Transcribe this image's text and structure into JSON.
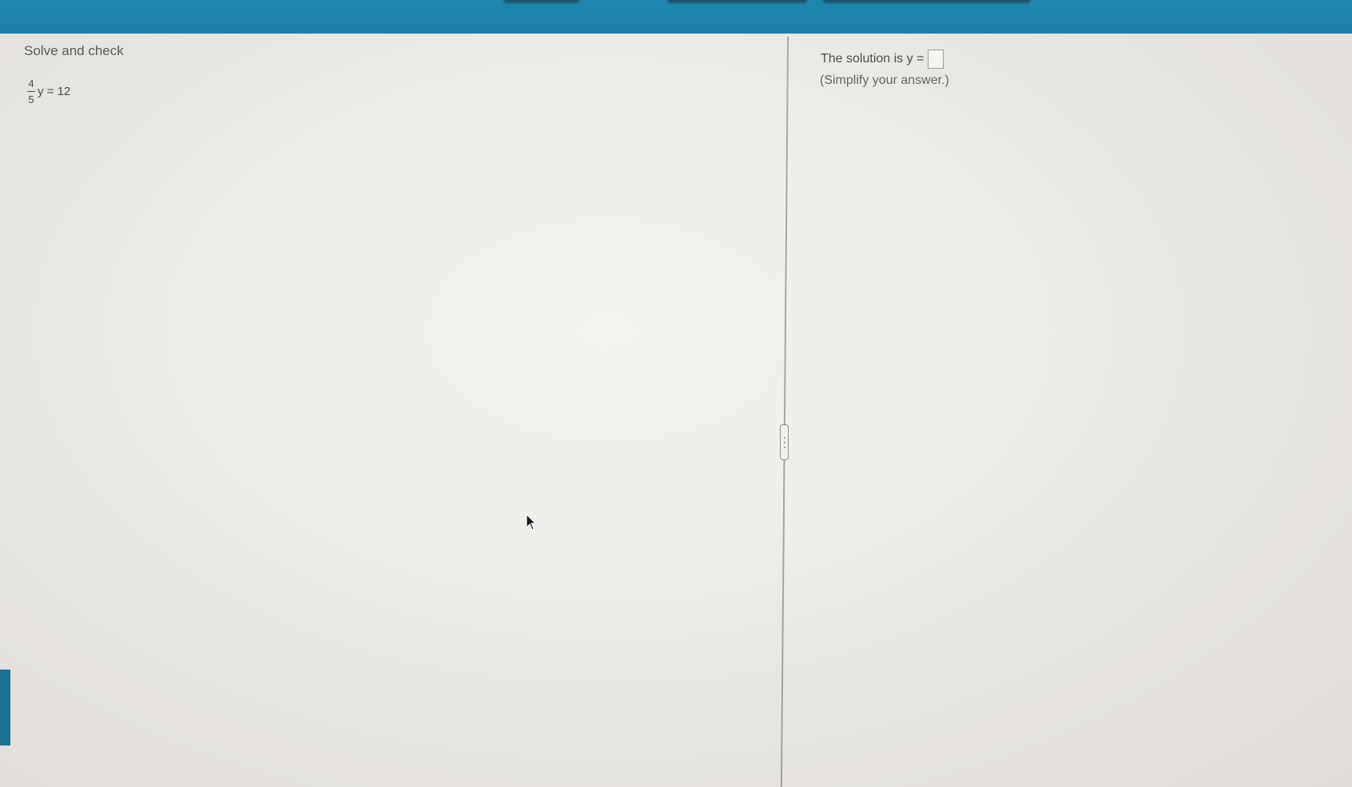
{
  "question": {
    "instruction": "Solve and check",
    "equation": {
      "numerator": "4",
      "denominator": "5",
      "rest": "y = 12"
    }
  },
  "answer": {
    "prefix": "The solution is y =",
    "value": "",
    "hint": "(Simplify your answer.)"
  },
  "icons": {
    "cursor": "mouse-pointer-icon",
    "divider_handle": "drag-handle-icon"
  },
  "colors": {
    "header": "#1e86ad",
    "side_tab": "#1e6f92"
  }
}
